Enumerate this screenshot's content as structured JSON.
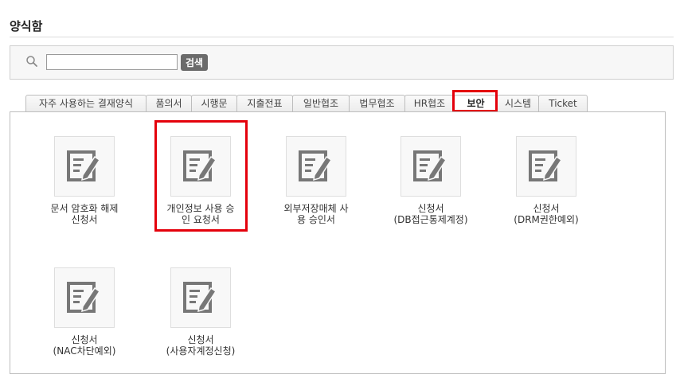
{
  "page": {
    "title": "양식함"
  },
  "search": {
    "placeholder": "",
    "value": "",
    "button_label": "검색"
  },
  "tabs": [
    {
      "label": "자주 사용하는 결재양식",
      "active": false
    },
    {
      "label": "품의서",
      "active": false
    },
    {
      "label": "시행문",
      "active": false
    },
    {
      "label": "지출전표",
      "active": false
    },
    {
      "label": "일반협조",
      "active": false
    },
    {
      "label": "법무협조",
      "active": false
    },
    {
      "label": "HR협조",
      "active": false
    },
    {
      "label": "보안",
      "active": true
    },
    {
      "label": "시스템",
      "active": false
    },
    {
      "label": "Ticket",
      "active": false
    }
  ],
  "forms": [
    {
      "label": "문서 암호화 해제\n신청서",
      "icon": "form-edit-icon"
    },
    {
      "label": "개인정보 사용 승\n인 요청서",
      "icon": "form-edit-icon"
    },
    {
      "label": "외부저장매체 사\n용 승인서",
      "icon": "form-edit-icon"
    },
    {
      "label": "신청서\n(DB접근통제계정)",
      "icon": "form-edit-icon"
    },
    {
      "label": "신청서\n(DRM권한예외)",
      "icon": "form-edit-icon"
    },
    {
      "label": "신청서\n(NAC차단예외)",
      "icon": "form-edit-icon"
    },
    {
      "label": "신청서\n(사용자계정신청)",
      "icon": "form-edit-icon"
    }
  ],
  "colors": {
    "highlight": "#e4000b",
    "icon": "#777777",
    "button": "#6b6b6b"
  }
}
